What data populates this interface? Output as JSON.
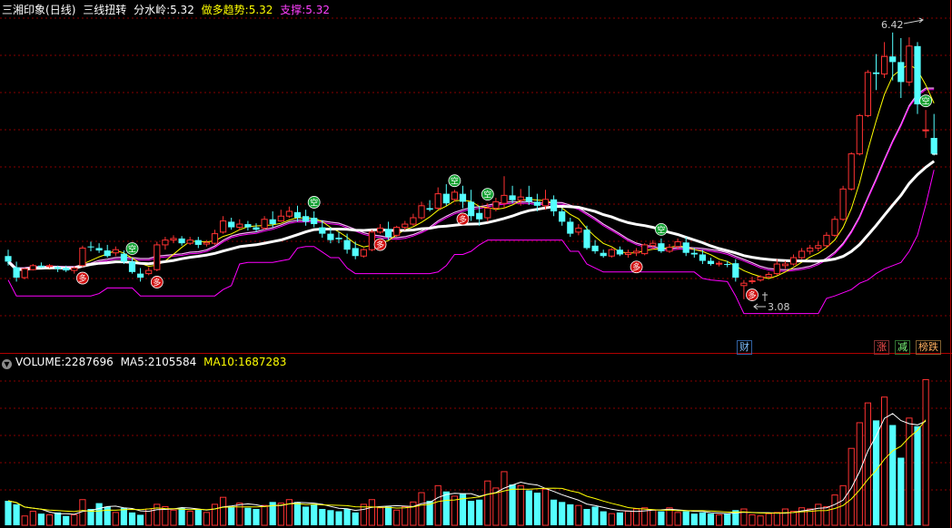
{
  "price_header": {
    "stock_name": "三湘印象",
    "period": "(日线)",
    "indicator_name": "三线扭转",
    "fenshuiling_label": "分水岭:",
    "fenshuiling_value": "5.32",
    "zuoduo_label": "做多趋势:",
    "zuoduo_value": "5.32",
    "zhicheng_label": "支撑:",
    "zhicheng_value": "5.32"
  },
  "volume_header": {
    "toggle_icon": "chevron-down-icon",
    "volume_label": "VOLUME:",
    "volume_value": "2287696",
    "ma5_label": "MA5:",
    "ma5_value": "2105584",
    "ma10_label": "MA10:",
    "ma10_value": "1687283"
  },
  "annotations": {
    "high_price": "6.42",
    "low_price": "3.08",
    "event_cai": "财",
    "event_zhang": "涨",
    "event_jian": "减",
    "event_bang": "榜",
    "event_die": "跌",
    "signal_duo": "多",
    "signal_kong": "空"
  },
  "colors": {
    "background": "#000000",
    "up": "#ff3232",
    "down": "#54ffff",
    "grid": "#880000",
    "ma_white": "#ffffff",
    "ma_yellow": "#ffff00",
    "ma_magenta": "#ff00ff",
    "pink_line": "#ffaaff",
    "header_yellow": "#ffff00",
    "header_magenta": "#ff40ff"
  },
  "chart_data": {
    "type": "candlestick",
    "price_range": [
      2.6,
      6.6
    ],
    "candles": [
      [
        3.62,
        3.7,
        3.55,
        3.5
      ],
      [
        3.48,
        3.55,
        3.35,
        3.3
      ],
      [
        3.35,
        3.47,
        3.46,
        3.33
      ],
      [
        3.45,
        3.52,
        3.5,
        3.44
      ],
      [
        3.5,
        3.54,
        3.48,
        3.47
      ],
      [
        3.49,
        3.52,
        3.5,
        3.47
      ],
      [
        3.48,
        3.5,
        3.46,
        3.42
      ],
      [
        3.47,
        3.5,
        3.44,
        3.42
      ],
      [
        3.44,
        3.49,
        3.47,
        3.4
      ],
      [
        3.5,
        3.75,
        3.72,
        3.48
      ],
      [
        3.74,
        3.8,
        3.73,
        3.68
      ],
      [
        3.72,
        3.78,
        3.69,
        3.66
      ],
      [
        3.69,
        3.76,
        3.62,
        3.6
      ],
      [
        3.66,
        3.74,
        3.7,
        3.62
      ],
      [
        3.65,
        3.69,
        3.55,
        3.52
      ],
      [
        3.55,
        3.6,
        3.42,
        3.4
      ],
      [
        3.4,
        3.47,
        3.35,
        3.3
      ],
      [
        3.4,
        3.48,
        3.44,
        3.38
      ],
      [
        3.45,
        3.8,
        3.76,
        3.43
      ],
      [
        3.76,
        3.86,
        3.82,
        3.7
      ],
      [
        3.82,
        3.88,
        3.84,
        3.78
      ],
      [
        3.84,
        3.87,
        3.78,
        3.75
      ],
      [
        3.78,
        3.86,
        3.82,
        3.76
      ],
      [
        3.82,
        3.86,
        3.76,
        3.72
      ],
      [
        3.77,
        3.82,
        3.79,
        3.74
      ],
      [
        3.78,
        3.95,
        3.9,
        3.76
      ],
      [
        3.92,
        4.12,
        4.06,
        3.9
      ],
      [
        4.05,
        4.1,
        3.98,
        3.95
      ],
      [
        3.98,
        4.08,
        4.02,
        3.94
      ],
      [
        4.02,
        4.06,
        3.98,
        3.94
      ],
      [
        3.98,
        4.03,
        3.95,
        3.92
      ],
      [
        3.97,
        4.12,
        4.08,
        3.95
      ],
      [
        4.08,
        4.18,
        4.02,
        3.98
      ],
      [
        4.06,
        4.2,
        4.12,
        4.05
      ],
      [
        4.12,
        4.24,
        4.18,
        4.1
      ],
      [
        4.17,
        4.25,
        4.1,
        4.05
      ],
      [
        4.12,
        4.2,
        4.05,
        4.0
      ],
      [
        4.1,
        4.18,
        4.02,
        3.98
      ],
      [
        3.98,
        4.07,
        3.9,
        3.85
      ],
      [
        3.9,
        3.98,
        3.82,
        3.78
      ],
      [
        3.85,
        3.92,
        3.83,
        3.78
      ],
      [
        3.82,
        3.9,
        3.7,
        3.65
      ],
      [
        3.72,
        3.8,
        3.62,
        3.58
      ],
      [
        3.62,
        3.72,
        3.7,
        3.6
      ],
      [
        3.7,
        3.95,
        3.92,
        3.68
      ],
      [
        3.92,
        4.02,
        3.97,
        3.9
      ],
      [
        3.96,
        4.05,
        3.86,
        3.82
      ],
      [
        3.88,
        4.0,
        3.98,
        3.86
      ],
      [
        3.98,
        4.06,
        4.02,
        3.94
      ],
      [
        4.02,
        4.15,
        4.1,
        4.0
      ],
      [
        4.1,
        4.3,
        4.25,
        4.08
      ],
      [
        4.22,
        4.32,
        4.2,
        4.18
      ],
      [
        4.22,
        4.48,
        4.4,
        4.2
      ],
      [
        4.4,
        4.52,
        4.28,
        4.25
      ],
      [
        4.33,
        4.45,
        4.42,
        4.3
      ],
      [
        4.4,
        4.5,
        4.3,
        4.22
      ],
      [
        4.3,
        4.45,
        4.12,
        4.06
      ],
      [
        4.16,
        4.25,
        4.08,
        4.0
      ],
      [
        4.1,
        4.28,
        4.22,
        4.05
      ],
      [
        4.22,
        4.35,
        4.3,
        4.18
      ],
      [
        4.28,
        4.62,
        4.38,
        4.22
      ],
      [
        4.38,
        4.5,
        4.32,
        4.28
      ],
      [
        4.32,
        4.46,
        4.36,
        4.25
      ],
      [
        4.36,
        4.5,
        4.3,
        4.26
      ],
      [
        4.3,
        4.4,
        4.25,
        4.18
      ],
      [
        4.25,
        4.45,
        4.33,
        4.2
      ],
      [
        4.33,
        4.38,
        4.18,
        4.12
      ],
      [
        4.18,
        4.22,
        4.05,
        4.0
      ],
      [
        4.05,
        4.1,
        3.9,
        3.86
      ],
      [
        3.92,
        4.02,
        3.97,
        3.88
      ],
      [
        3.95,
        4.0,
        3.72,
        3.7
      ],
      [
        3.75,
        3.82,
        3.68,
        3.65
      ],
      [
        3.66,
        3.7,
        3.62,
        3.6
      ],
      [
        3.62,
        3.72,
        3.7,
        3.6
      ],
      [
        3.7,
        3.74,
        3.64,
        3.62
      ],
      [
        3.64,
        3.7,
        3.66,
        3.6
      ],
      [
        3.66,
        3.72,
        3.68,
        3.62
      ],
      [
        3.65,
        3.78,
        3.76,
        3.63
      ],
      [
        3.75,
        3.82,
        3.78,
        3.7
      ],
      [
        3.78,
        3.84,
        3.68,
        3.66
      ],
      [
        3.68,
        3.77,
        3.73,
        3.66
      ],
      [
        3.74,
        3.84,
        3.8,
        3.7
      ],
      [
        3.79,
        3.86,
        3.66,
        3.62
      ],
      [
        3.66,
        3.72,
        3.64,
        3.6
      ],
      [
        3.64,
        3.7,
        3.56,
        3.52
      ],
      [
        3.56,
        3.6,
        3.52,
        3.5
      ],
      [
        3.52,
        3.56,
        3.53,
        3.49
      ],
      [
        3.52,
        3.56,
        3.51,
        3.48
      ],
      [
        3.53,
        3.58,
        3.35,
        3.3
      ],
      [
        3.25,
        3.32,
        3.28,
        3.08
      ],
      [
        3.3,
        3.36,
        3.31,
        3.27
      ],
      [
        3.32,
        3.38,
        3.36,
        3.3
      ],
      [
        3.36,
        3.42,
        3.39,
        3.34
      ],
      [
        3.4,
        3.58,
        3.52,
        3.38
      ],
      [
        3.5,
        3.56,
        3.52,
        3.46
      ],
      [
        3.52,
        3.64,
        3.6,
        3.5
      ],
      [
        3.6,
        3.72,
        3.68,
        3.58
      ],
      [
        3.68,
        3.76,
        3.72,
        3.64
      ],
      [
        3.72,
        3.8,
        3.75,
        3.68
      ],
      [
        3.75,
        3.92,
        3.88,
        3.72
      ],
      [
        3.88,
        4.12,
        4.08,
        3.86
      ],
      [
        4.08,
        4.5,
        4.46,
        4.06
      ],
      [
        4.46,
        4.92,
        4.9,
        4.44
      ],
      [
        4.9,
        5.4,
        5.38,
        4.88
      ],
      [
        5.38,
        5.95,
        5.92,
        5.36
      ],
      [
        5.92,
        6.15,
        5.9,
        5.7
      ],
      [
        5.9,
        6.3,
        6.12,
        5.85
      ],
      [
        6.12,
        6.42,
        6.05,
        5.82
      ],
      [
        6.05,
        6.35,
        5.8,
        5.6
      ],
      [
        5.8,
        6.36,
        6.25,
        5.75
      ],
      [
        6.25,
        6.3,
        5.52,
        5.4
      ],
      [
        5.2,
        5.45,
        5.2,
        5.1
      ],
      [
        5.1,
        5.4,
        4.9,
        4.88
      ]
    ],
    "volumes": [
      21,
      18,
      8,
      12,
      10,
      9,
      11,
      8,
      9,
      22,
      14,
      19,
      16,
      11,
      15,
      11,
      9,
      14,
      18,
      16,
      13,
      15,
      12,
      14,
      11,
      18,
      24,
      16,
      19,
      15,
      14,
      17,
      20,
      19,
      22,
      20,
      16,
      18,
      14,
      13,
      12,
      14,
      11,
      18,
      22,
      15,
      16,
      13,
      16,
      20,
      28,
      21,
      34,
      29,
      25,
      27,
      21,
      22,
      38,
      32,
      46,
      35,
      34,
      30,
      28,
      31,
      22,
      20,
      18,
      17,
      14,
      16,
      12,
      10,
      11,
      12,
      14,
      15,
      13,
      12,
      15,
      11,
      12,
      10,
      11,
      10,
      9,
      10,
      13,
      14,
      9,
      8,
      10,
      11,
      14,
      12,
      15,
      14,
      18,
      16,
      26,
      34,
      66,
      88,
      105,
      90,
      110,
      86,
      58,
      92,
      85,
      125
    ],
    "volume_range": [
      0,
      130
    ],
    "series": [
      {
        "name": "MA5",
        "values": []
      },
      {
        "name": "MA10",
        "values": []
      }
    ],
    "signals": [
      {
        "index": 9,
        "type": "多"
      },
      {
        "index": 15,
        "type": "空"
      },
      {
        "index": 18,
        "type": "多"
      },
      {
        "index": 37,
        "type": "空"
      },
      {
        "index": 45,
        "type": "多"
      },
      {
        "index": 54,
        "type": "空"
      },
      {
        "index": 55,
        "type": "多"
      },
      {
        "index": 58,
        "type": "空"
      },
      {
        "index": 76,
        "type": "多"
      },
      {
        "index": 79,
        "type": "空"
      },
      {
        "index": 90,
        "type": "多"
      },
      {
        "index": 111,
        "type": "空"
      }
    ],
    "grid": true
  }
}
